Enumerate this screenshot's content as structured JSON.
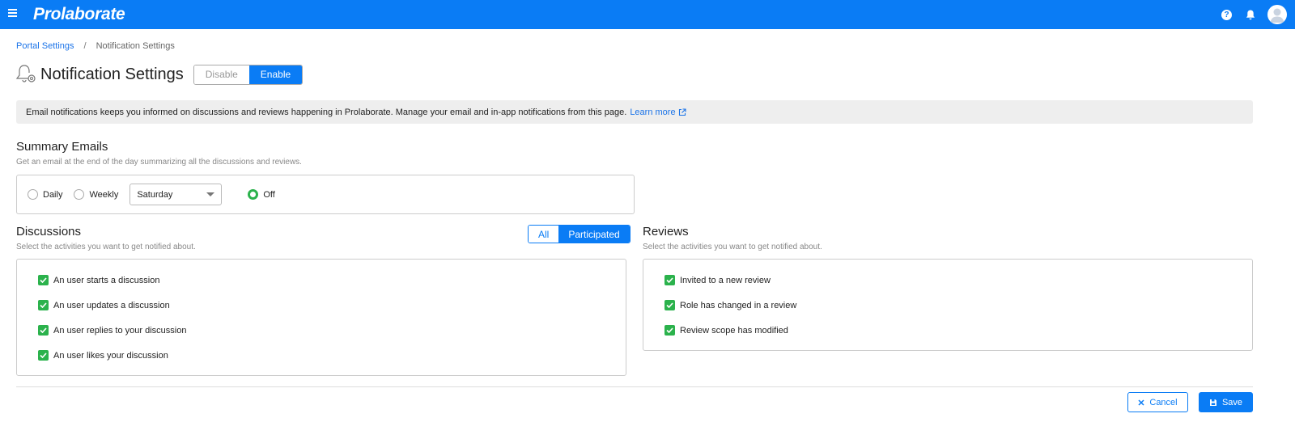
{
  "app": {
    "brand": "Prolaborate",
    "accent_color": "#0a7cf5",
    "check_color": "#2bb24c",
    "icons": [
      "menu-icon",
      "help-icon",
      "bell-icon",
      "avatar-icon"
    ]
  },
  "breadcrumb": {
    "parent": "Portal Settings",
    "separator": "/",
    "current": "Notification Settings"
  },
  "page": {
    "title": "Notification Settings",
    "toggle": {
      "disable": "Disable",
      "enable": "Enable",
      "selected": "Enable"
    }
  },
  "info": {
    "text": "Email notifications keeps you informed on discussions and reviews happening in Prolaborate. Manage your email and in-app notifications from this page.",
    "link": "Learn more"
  },
  "summary": {
    "title": "Summary Emails",
    "subtitle": "Get an email at the end of the day summarizing all the discussions and reviews.",
    "options": {
      "daily": "Daily",
      "weekly": "Weekly",
      "off": "Off"
    },
    "selected": "Off",
    "day_select": "Saturday"
  },
  "discussions": {
    "title": "Discussions",
    "subtitle": "Select the activities you want to get notified about.",
    "scope": {
      "all": "All",
      "participated": "Participated",
      "selected": "Participated"
    },
    "items": [
      {
        "label": "An user starts a discussion",
        "checked": true
      },
      {
        "label": "An user updates a discussion",
        "checked": true
      },
      {
        "label": "An user replies to your discussion",
        "checked": true
      },
      {
        "label": "An user likes your discussion",
        "checked": true
      }
    ]
  },
  "reviews": {
    "title": "Reviews",
    "subtitle": "Select the activities you want to get notified about.",
    "items": [
      {
        "label": "Invited to a new review",
        "checked": true
      },
      {
        "label": "Role has changed in a review",
        "checked": true
      },
      {
        "label": "Review scope has modified",
        "checked": true
      }
    ]
  },
  "actions": {
    "cancel": "Cancel",
    "save": "Save"
  }
}
